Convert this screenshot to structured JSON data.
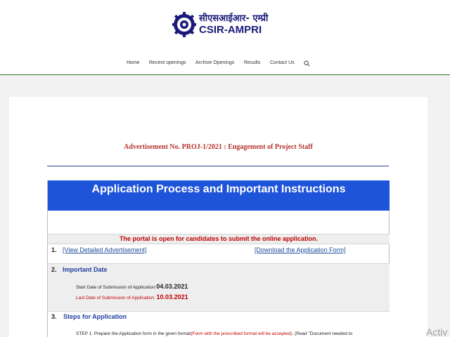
{
  "header": {
    "logo_hindi": "सीएसआईआर- एम्प्री",
    "logo_text": "CSIR-AMPRI"
  },
  "nav": {
    "items": [
      "Home",
      "Recent openings",
      "Archive Openings",
      "Results",
      "Contact Us"
    ],
    "search_icon": "search-icon"
  },
  "content": {
    "advertisement_title": "Advertisement No. PROJ-1/2021 : Engagement of Project Staff",
    "panel_title": "Application Process and Important Instructions",
    "portal_notice": "The portal is open for candidates to submit the online application.",
    "row1": {
      "number": "1.",
      "link_advertisement": "[View Detailed Advertisement]",
      "link_form": "[Download the Application Form]"
    },
    "row2": {
      "number": "2.",
      "title": "Important Date",
      "start_label": "Start Date of Submission of Application:",
      "start_value": "04.03.2021",
      "last_label": "Last Date of Submission of Application: ",
      "last_value": "10.03.2021"
    },
    "row3": {
      "number": "3.",
      "title": "Steps for Application",
      "step1_text": "STEP 1: Prepare the Application form in the given format",
      "step1_red": "(Form with the prescribed format will be accepted)",
      "step1_tail": ". (Read \"Document needed to"
    }
  },
  "overlay": {
    "watermark": "Activ"
  },
  "colors": {
    "panel_blue": "#1e54d9",
    "accent_red": "#c00000",
    "link_blue": "#1f4e9c",
    "header_rule": "#3a6e2f"
  }
}
